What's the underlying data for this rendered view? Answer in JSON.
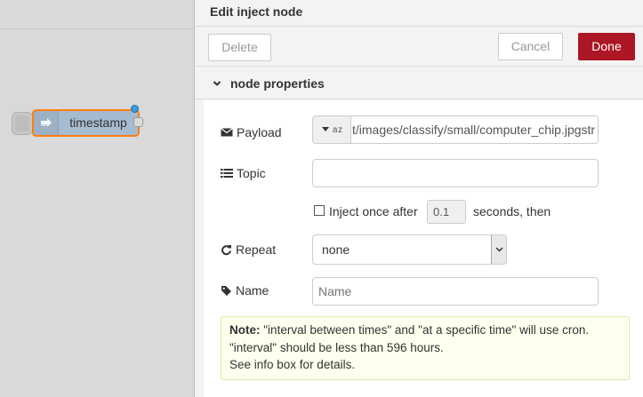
{
  "canvas": {
    "node_label": "timestamp"
  },
  "tray": {
    "title": "Edit inject node",
    "toolbar": {
      "delete_label": "Delete",
      "cancel_label": "Cancel",
      "done_label": "Done"
    },
    "section_title": "node properties",
    "payload": {
      "label": "Payload",
      "type_indicator": "a z",
      "value": "t/images/classify/small/computer_chip.jpgstr"
    },
    "topic": {
      "label": "Topic",
      "value": ""
    },
    "inject_once": {
      "label": "Inject once after",
      "checked": false,
      "delay": "0.1",
      "suffix": "seconds, then"
    },
    "repeat": {
      "label": "Repeat",
      "selected": "none"
    },
    "name": {
      "label": "Name",
      "placeholder": "Name"
    },
    "note": {
      "prefix": "Note:",
      "line1": "\"interval between times\" and \"at a specific time\" will use cron.",
      "line2": "\"interval\" should be less than 596 hours.",
      "line3": "See info box for details."
    }
  },
  "colors": {
    "done_button": "#ad1625",
    "node_fill": "#a6bbcf",
    "node_selected_border": "#ff7f0e",
    "status_dot": "#3a9cd8",
    "note_bg": "#ffffee"
  }
}
